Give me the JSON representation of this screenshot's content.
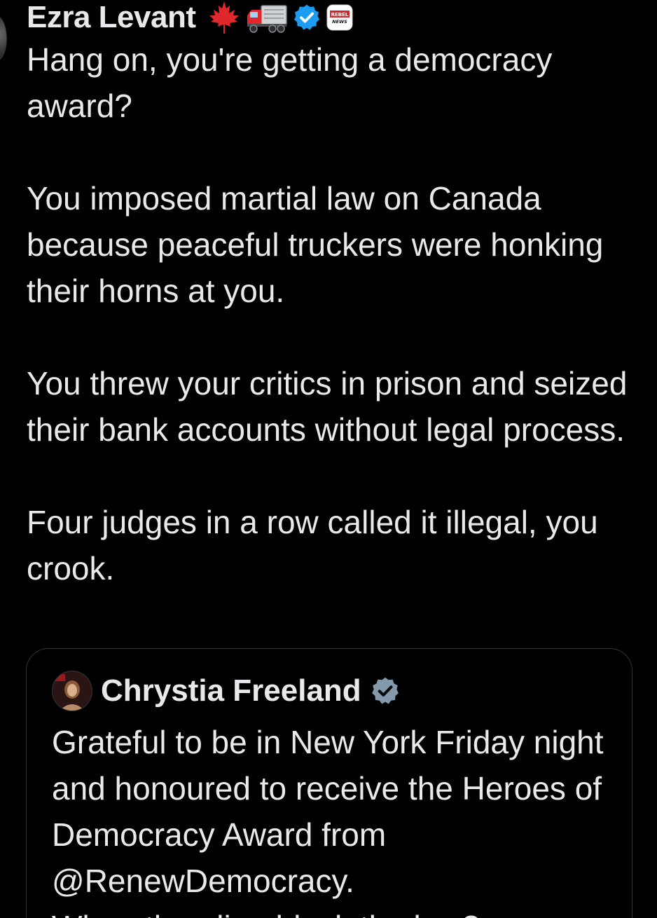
{
  "tweet": {
    "author_name": "Ezra Levant",
    "paragraphs": [
      "Hang on, you're getting a democracy award?",
      "You imposed martial law on Canada because peaceful truckers were honking their horns at you.",
      "You threw your critics in prison and seized their bank accounts without legal process.",
      "Four judges in a row called it illegal, you crook."
    ],
    "badges": {
      "maple_leaf": "maple-leaf-icon",
      "truck": "truck-icon",
      "verified": "verified-badge-icon",
      "rebel_news": "REBEL NEWS"
    }
  },
  "quoted_tweet": {
    "author_name": "Chrystia Freeland",
    "text": "Grateful to be in New York Friday night and honoured to receive the Heroes of Democracy Award from @RenewDemocracy.",
    "next_line_fragment": "When the alien block the law?",
    "verified_badge": "verified-badge-gray-icon"
  },
  "colors": {
    "background": "#000000",
    "text": "#e7e9ea",
    "border": "#2f3336",
    "verified_blue": "#1d9bf0",
    "verified_gray": "#829aab",
    "maple_red": "#e0282c"
  }
}
